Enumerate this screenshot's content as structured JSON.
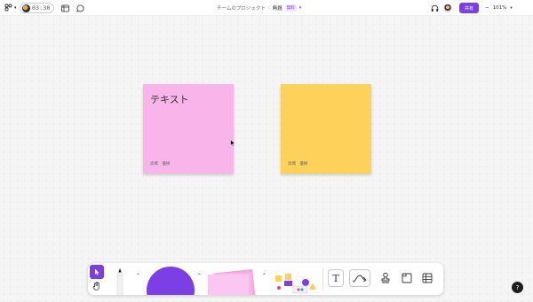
{
  "topbar": {
    "timer": "03:30",
    "breadcrumb_team": "チームのプロジェクト",
    "separator": "/",
    "file_title": "無題",
    "plan_badge": "無料",
    "share_label": "共有",
    "zoom_level": "101%"
  },
  "canvas": {
    "stickies": [
      {
        "text": "テキスト",
        "author": "高橋 優樹",
        "color": "#f9b5ea"
      },
      {
        "text": "",
        "author": "高橋 優樹",
        "color": "#fed15a"
      }
    ]
  },
  "toolbar": {
    "accent_color": "#7b3fe4",
    "text_tool_label": "T",
    "tools": [
      "select-tool",
      "hand-tool",
      "pen-tool",
      "shape-tool",
      "sticky-tool",
      "stamp-tool",
      "text-tool",
      "connector-tool",
      "stamp-stencil-tool",
      "section-tool",
      "table-tool"
    ]
  },
  "help_label": "?"
}
